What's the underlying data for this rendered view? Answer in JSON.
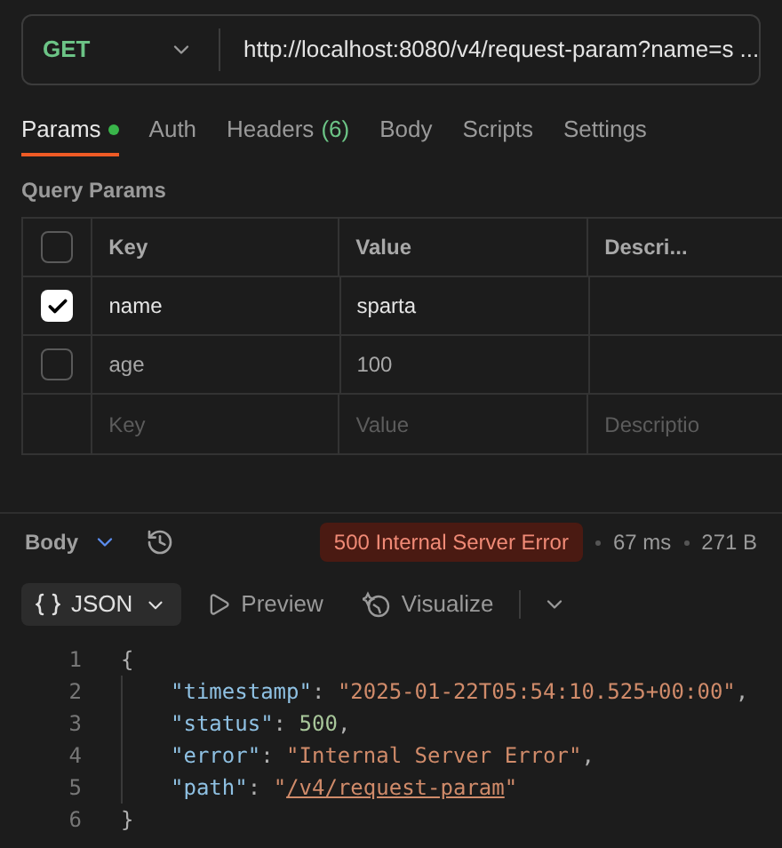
{
  "request": {
    "method": "GET",
    "url": "http://localhost:8080/v4/request-param?name=s ..."
  },
  "tabs": [
    {
      "label": "Params",
      "selected": true,
      "dot": true
    },
    {
      "label": "Auth",
      "selected": false
    },
    {
      "label": "Headers",
      "count": "(6)",
      "selected": false
    },
    {
      "label": "Body",
      "selected": false
    },
    {
      "label": "Scripts",
      "selected": false
    },
    {
      "label": "Settings",
      "selected": false
    }
  ],
  "query_params": {
    "title": "Query Params",
    "select_all_checked": false,
    "columns": [
      "Key",
      "Value",
      "Descri..."
    ],
    "rows": [
      {
        "key": "name",
        "value": "sparta",
        "checked": true
      },
      {
        "key": "age",
        "value": "100",
        "checked": false
      }
    ],
    "new_row": {
      "key_placeholder": "Key",
      "value_placeholder": "Value",
      "description_placeholder": "Descriptio"
    }
  },
  "response": {
    "label": "Body",
    "status": "500 Internal Server Error",
    "time": "67 ms",
    "size": "271 B"
  },
  "view": {
    "format": "JSON",
    "options": [
      "Preview",
      "Visualize"
    ]
  },
  "code": [
    [
      {
        "kind": "punct",
        "text": "{"
      }
    ],
    [
      {
        "kind": "key",
        "text": "\"timestamp\""
      },
      {
        "kind": "punct",
        "text": ": "
      },
      {
        "kind": "string",
        "text": "\"2025-01-22T05:54:10.525+00:00\""
      },
      {
        "kind": "punct",
        "text": ","
      }
    ],
    [
      {
        "kind": "key",
        "text": "\"status\""
      },
      {
        "kind": "punct",
        "text": ": "
      },
      {
        "kind": "number",
        "text": "500"
      },
      {
        "kind": "punct",
        "text": ","
      }
    ],
    [
      {
        "kind": "key",
        "text": "\"error\""
      },
      {
        "kind": "punct",
        "text": ": "
      },
      {
        "kind": "string",
        "text": "\"Internal Server Error\""
      },
      {
        "kind": "punct",
        "text": ","
      }
    ],
    [
      {
        "kind": "key",
        "text": "\"path\""
      },
      {
        "kind": "punct",
        "text": ": "
      },
      {
        "kind": "string",
        "text": "\""
      },
      {
        "kind": "link",
        "text": "/v4/request-param"
      },
      {
        "kind": "string",
        "text": "\""
      }
    ],
    [
      {
        "kind": "punct",
        "text": "}"
      }
    ]
  ],
  "line_numbers": [
    "1",
    "2",
    "3",
    "4",
    "5",
    "6"
  ]
}
